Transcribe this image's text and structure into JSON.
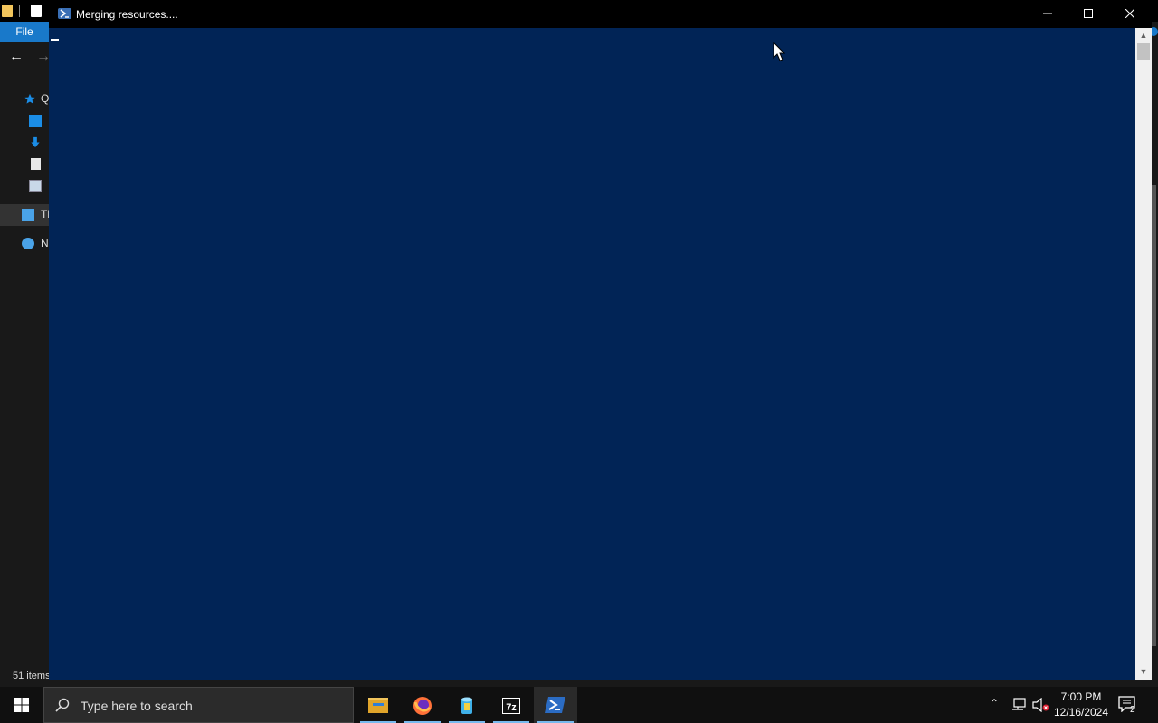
{
  "explorer": {
    "file_tab": "File",
    "nav_items": [
      {
        "label": "Q",
        "icon": "quick-access-star-icon"
      },
      {
        "label": "",
        "icon": "desktop-icon"
      },
      {
        "label": "",
        "icon": "downloads-icon"
      },
      {
        "label": "",
        "icon": "documents-icon"
      },
      {
        "label": "",
        "icon": "pictures-icon"
      },
      {
        "label": "Th",
        "icon": "this-pc-icon"
      },
      {
        "label": "N",
        "icon": "network-icon"
      }
    ],
    "status": "51 items"
  },
  "powershell": {
    "title": "Merging resources....",
    "icon": "powershell-icon",
    "background": "#012456"
  },
  "taskbar": {
    "search_placeholder": "Type here to search",
    "apps": [
      {
        "name": "File Explorer",
        "icon": "file-explorer-icon",
        "running": true
      },
      {
        "name": "Firefox",
        "icon": "firefox-icon",
        "running": true
      },
      {
        "name": "App",
        "icon": "app-cylinder-icon",
        "running": true
      },
      {
        "name": "7-Zip",
        "icon": "7zip-icon",
        "label": "7z",
        "running": true
      },
      {
        "name": "Windows PowerShell",
        "icon": "powershell-icon",
        "running": true,
        "active": true
      }
    ],
    "clock": {
      "time": "7:00 PM",
      "date": "12/16/2024"
    },
    "notification_count": "2"
  }
}
